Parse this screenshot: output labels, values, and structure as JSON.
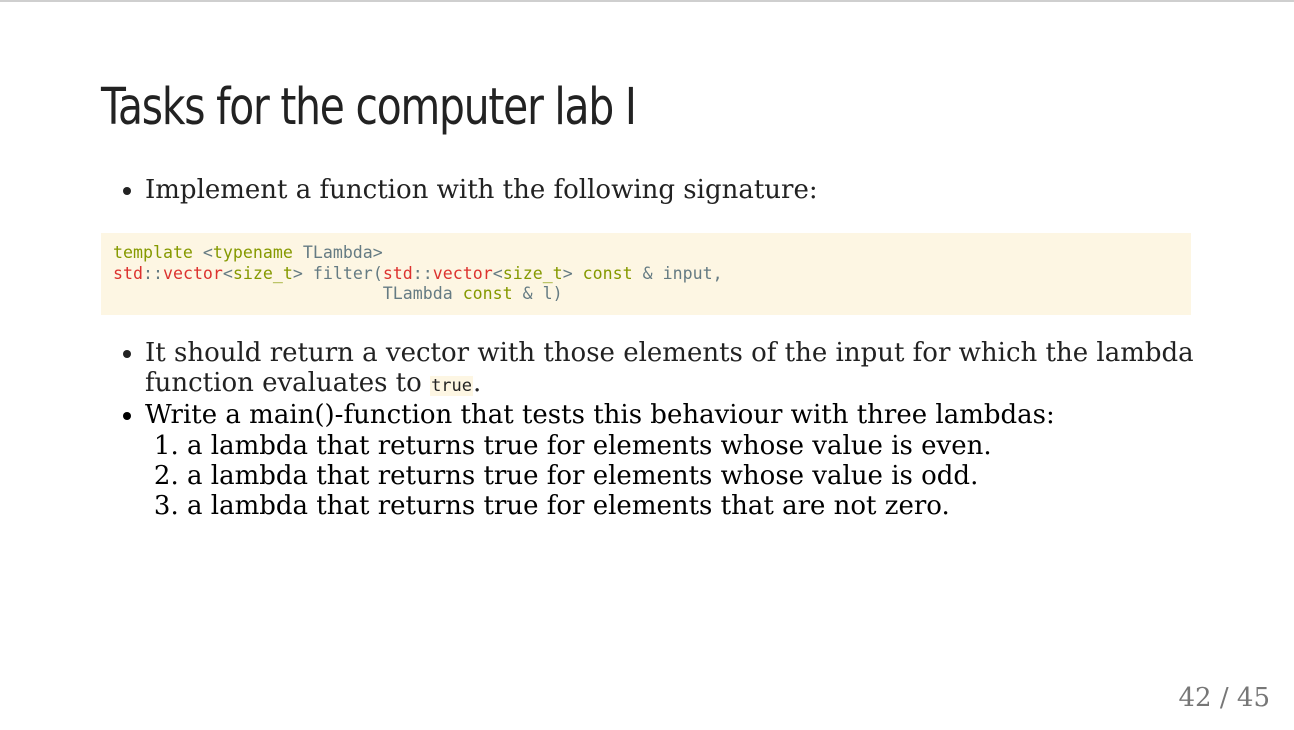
{
  "title": "Tasks for the computer lab I",
  "bullet1": "Implement a function with the following signature:",
  "code": {
    "l1_template": "template",
    "l1_typename": "typename",
    "l1_name": "TLambda",
    "std": "std",
    "vector": "vector",
    "size_t": "size_t",
    "filter": "filter",
    "const": "const",
    "input": "input",
    "tlambda": "TLambda",
    "l": "l"
  },
  "bullet2_text": "It should return a vector with those elements of the input for which the lambda function evaluates to",
  "bullet2_code": "true",
  "bullet2_end": ".",
  "bullet3": "Write a main()-function that tests this behaviour with three lambdas:",
  "subitems": [
    "a lambda that returns true for elements whose value is even.",
    "a lambda that returns true for elements whose value is odd.",
    "a lambda that returns true for elements that are not zero."
  ],
  "page": {
    "current": "42",
    "separator": "/",
    "total": "45"
  }
}
